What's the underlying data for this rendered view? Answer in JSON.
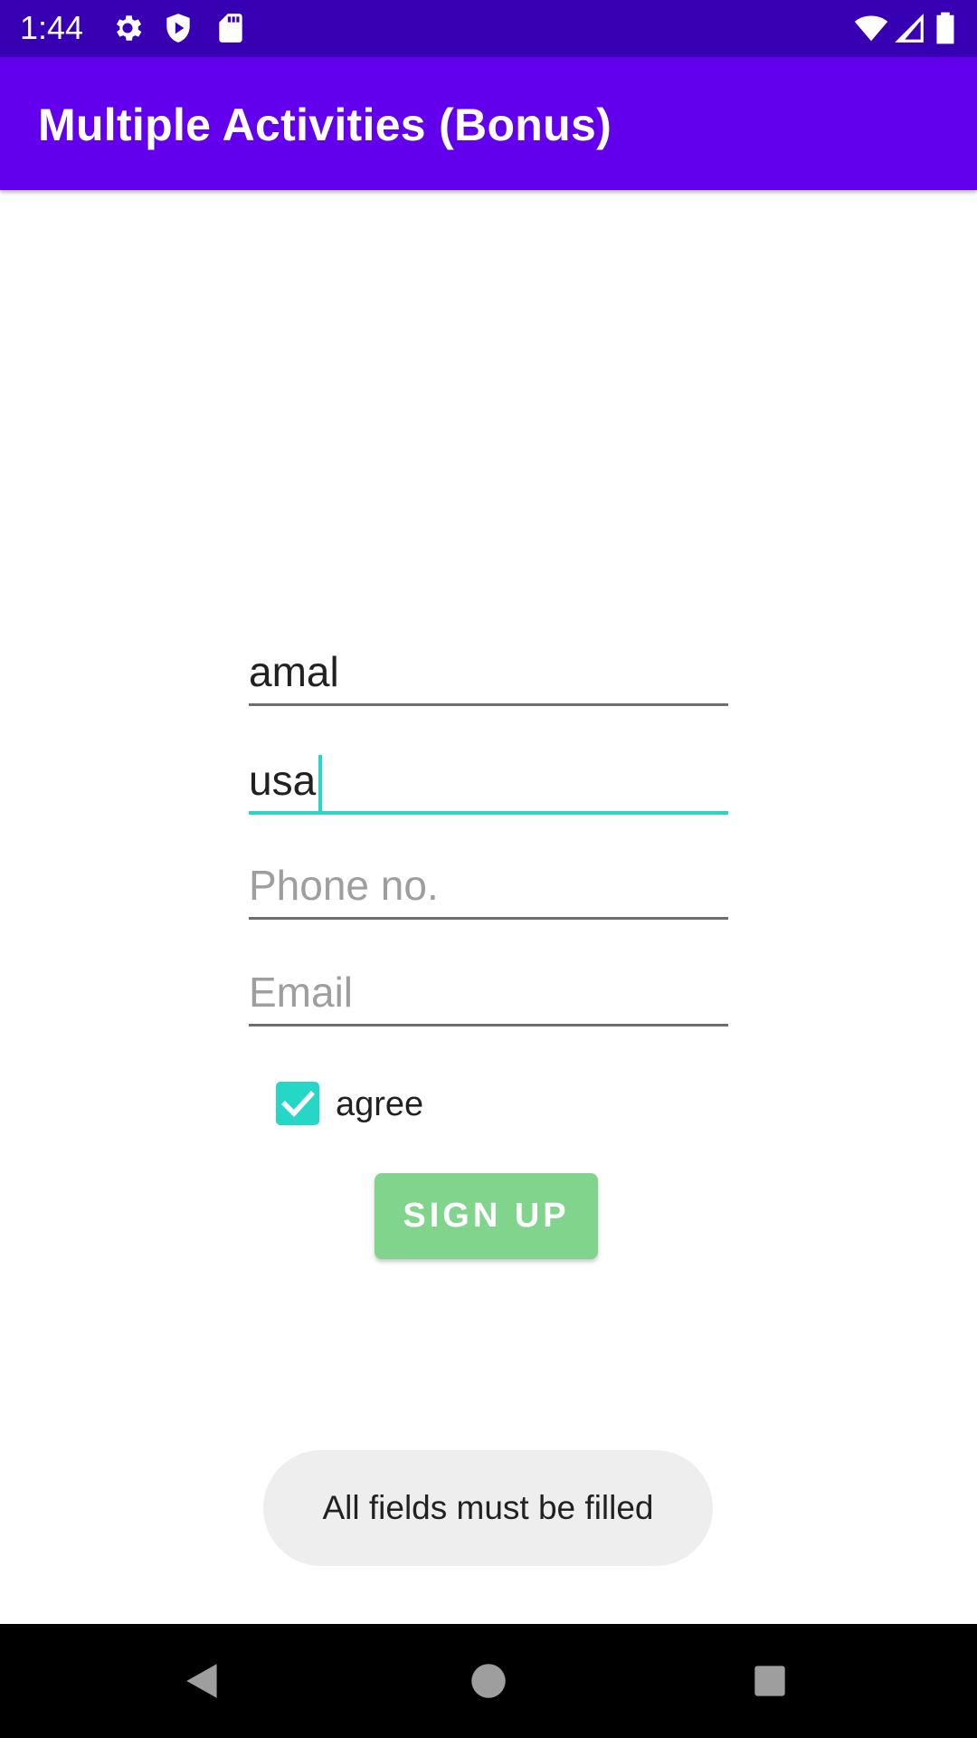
{
  "status_bar": {
    "time": "1:44",
    "icons_left": [
      "gear-icon",
      "shield-play-icon",
      "sd-card-icon"
    ],
    "icons_right": [
      "wifi-icon",
      "cell-signal-icon",
      "battery-icon"
    ]
  },
  "app_bar": {
    "title": "Multiple Activities (Bonus)"
  },
  "form": {
    "name_value": "amal",
    "country_value": "usa",
    "phone_placeholder": "Phone no.",
    "phone_value": "",
    "email_placeholder": "Email",
    "email_value": "",
    "agree_label": "agree",
    "agree_checked": true,
    "signup_label": "SIGN UP"
  },
  "toast": {
    "message": "All fields must be filled"
  },
  "nav_bar": {
    "buttons": [
      "back-icon",
      "home-icon",
      "recents-icon"
    ]
  },
  "colors": {
    "status_bar": "#3700b3",
    "app_bar": "#6200ee",
    "accent": "#26d7c8",
    "button": "#81d48b"
  }
}
